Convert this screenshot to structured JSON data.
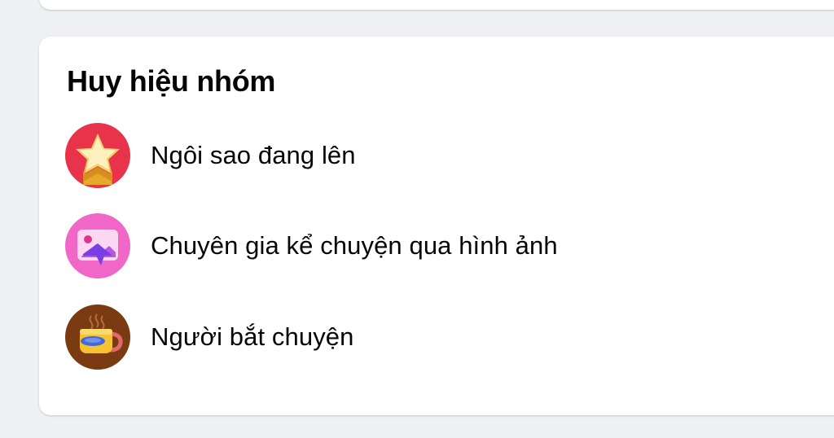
{
  "group_badges": {
    "title": "Huy hiệu nhóm",
    "items": [
      {
        "label": "Ngôi sao đang lên",
        "icon": "rising-star-icon",
        "bg_color": "#e8334a"
      },
      {
        "label": "Chuyên gia kể chuyện qua hình ảnh",
        "icon": "visual-storyteller-icon",
        "bg_color": "#f067c8"
      },
      {
        "label": "Người bắt chuyện",
        "icon": "conversation-starter-icon",
        "bg_color": "#7a3b12"
      }
    ]
  }
}
